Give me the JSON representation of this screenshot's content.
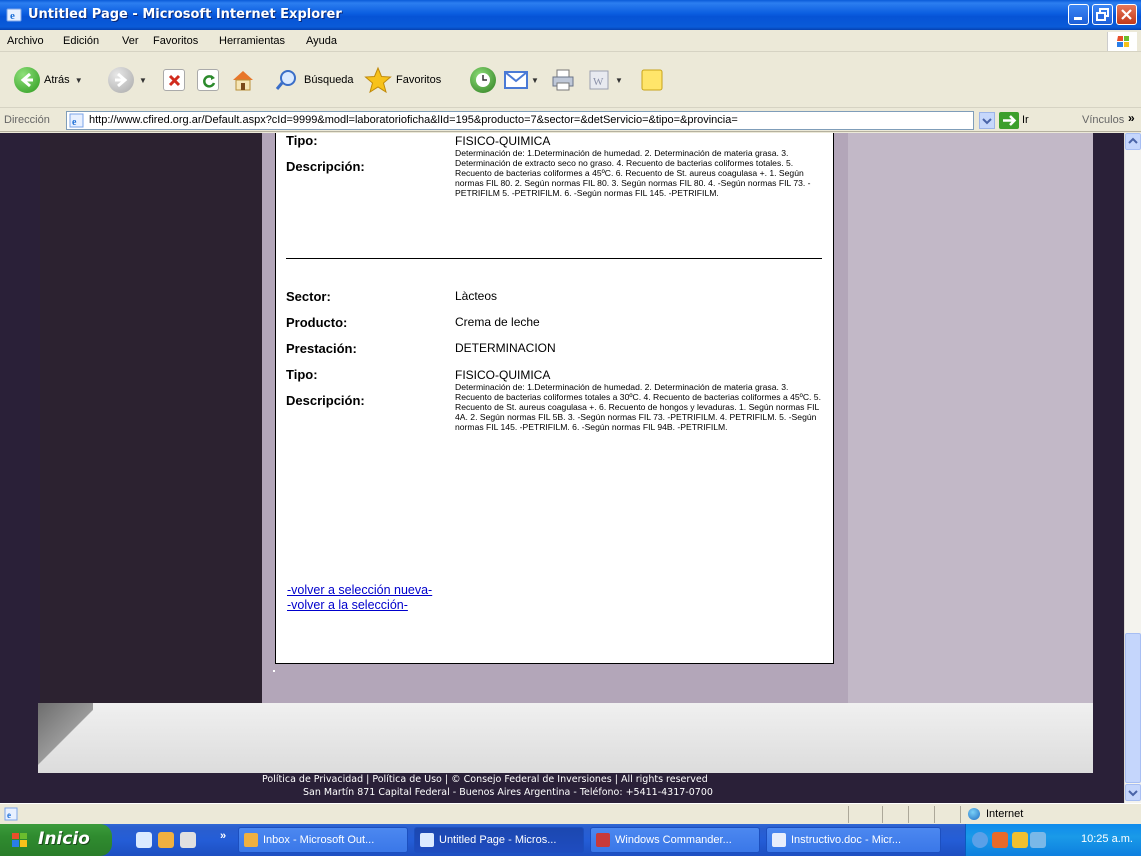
{
  "window": {
    "title": "Untitled Page - Microsoft Internet Explorer"
  },
  "menu": [
    "Archivo",
    "Edición",
    "Ver",
    "Favoritos",
    "Herramientas",
    "Ayuda"
  ],
  "toolbar": {
    "back_label": "Atrás",
    "search_label": "Búsqueda",
    "favorites_label": "Favoritos"
  },
  "address": {
    "label": "Dirección",
    "url": "http://www.cfired.org.ar/Default.aspx?cId=9999&modl=laboratorioficha&lId=195&producto=7&sector=&detServicio=&tipo=&provincia=",
    "go_label": "Ir",
    "links_label": "Vínculos"
  },
  "page": {
    "record1": {
      "tipo_label": "Tipo:",
      "tipo_value": "FISICO-QUIMICA",
      "descripcion_label": "Descripción:",
      "descripcion_value": "Determinación de: 1.Determinación de humedad. 2. Determinación de materia grasa. 3. Determinación de extracto seco no graso. 4. Recuento de bacterias coliformes totales. 5. Recuento de bacterias coliformes a 45ºC. 6. Recuento de St. aureus coagulasa +. 1. Según normas FIL 80. 2. Según normas FIL 80. 3. Según normas FIL 80. 4. -Según normas FIL 73. -PETRIFILM 5. -PETRIFILM. 6. -Según normas FIL 145. -PETRIFILM."
    },
    "record2": {
      "sector_label": "Sector:",
      "sector_value": "Làcteos",
      "producto_label": "Producto:",
      "producto_value": "Crema de leche",
      "prestacion_label": "Prestación:",
      "prestacion_value": "DETERMINACION",
      "tipo_label": "Tipo:",
      "tipo_value": "FISICO-QUIMICA",
      "descripcion_label": "Descripción:",
      "descripcion_value": "Determinación de: 1.Determinación de humedad. 2. Determinación de materia grasa. 3. Recuento de bacterias coliformes totales a 30ºC. 4. Recuento de bacterias coliformes a 45ºC. 5. Recuento de St. aureus coagulasa +. 6. Recuento de hongos y levaduras. 1. Según normas FIL 4A. 2. Según normas FIL 5B. 3. -Según normas FIL 73. -PETRIFILM. 4. PETRIFILM. 5. -Según normas FIL 145. -PETRIFILM. 6. -Según normas FIL 94B. -PETRIFILM."
    },
    "links": {
      "new_selection": "-volver a selección nueva-",
      "back_selection": "-volver a la selección-"
    },
    "footer": {
      "line1": "Política de Privacidad | Política de Uso | © Consejo Federal de Inversiones | All rights reserved",
      "line2": "San Martín 871 Capital Federal - Buenos Aires Argentina  - Teléfono: +5411-4317-0700"
    }
  },
  "status": {
    "zone": "Internet"
  },
  "taskbar": {
    "start_label": "Inicio",
    "tasks": [
      "Inbox - Microsoft Out...",
      "Untitled Page - Micros...",
      "Windows Commander...",
      "Instructivo.doc - Micr..."
    ],
    "clock": "10:25 a.m."
  },
  "colors": {
    "title_blue": "#0a5bd8",
    "page_dark": "#2a2038",
    "page_mauve": "#c2b8c7",
    "link": "#0000cc",
    "start_green": "#2f8b2f"
  }
}
